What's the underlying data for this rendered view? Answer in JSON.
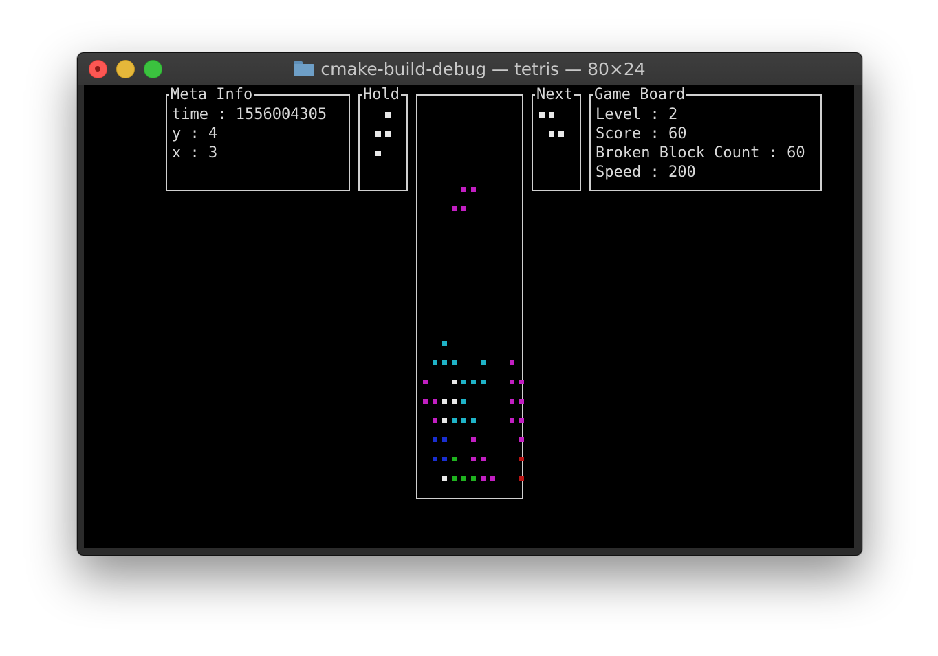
{
  "window": {
    "title": "cmake-build-debug — tetris — 80×24",
    "icon": "folder-icon"
  },
  "meta_info": {
    "label": "Meta Info",
    "time_line": "time : 1556004305",
    "y_line": "y : 4",
    "x_line": "x : 3"
  },
  "hold": {
    "label": "Hold"
  },
  "next": {
    "label": "Next"
  },
  "game_board": {
    "label": "Game Board",
    "level_line": "Level : 2",
    "score_line": "Score : 60",
    "broken_line": "Broken Block Count : 60",
    "speed_line": "Speed : 200"
  },
  "colors": {
    "magenta": "#c21fc2",
    "cyan": "#1fb3c7",
    "white": "#e8e8e8",
    "blue": "#1a2fd0",
    "green": "#1fb31f",
    "red": "#b81414"
  },
  "hold_piece": [
    [
      1,
      0
    ],
    [
      0,
      1
    ],
    [
      1,
      1
    ],
    [
      0,
      2
    ]
  ],
  "next_piece": [
    [
      0,
      0
    ],
    [
      1,
      0
    ],
    [
      1,
      1
    ],
    [
      2,
      1
    ]
  ],
  "falling_piece": [
    {
      "col": 4,
      "row": 5,
      "c": "magenta"
    },
    {
      "col": 5,
      "row": 5,
      "c": "magenta"
    },
    {
      "col": 3,
      "row": 6,
      "c": "magenta"
    },
    {
      "col": 4,
      "row": 6,
      "c": "magenta"
    }
  ],
  "stack": [
    {
      "col": 2,
      "row": 13,
      "c": "cyan"
    },
    {
      "col": 1,
      "row": 14,
      "c": "cyan"
    },
    {
      "col": 2,
      "row": 14,
      "c": "cyan"
    },
    {
      "col": 3,
      "row": 14,
      "c": "cyan"
    },
    {
      "col": 6,
      "row": 14,
      "c": "cyan"
    },
    {
      "col": 9,
      "row": 14,
      "c": "magenta"
    },
    {
      "col": 0,
      "row": 15,
      "c": "magenta"
    },
    {
      "col": 3,
      "row": 15,
      "c": "white"
    },
    {
      "col": 4,
      "row": 15,
      "c": "cyan"
    },
    {
      "col": 5,
      "row": 15,
      "c": "cyan"
    },
    {
      "col": 6,
      "row": 15,
      "c": "cyan"
    },
    {
      "col": 9,
      "row": 15,
      "c": "magenta"
    },
    {
      "col": 10,
      "row": 15,
      "c": "magenta"
    },
    {
      "col": 0,
      "row": 16,
      "c": "magenta"
    },
    {
      "col": 1,
      "row": 16,
      "c": "magenta"
    },
    {
      "col": 2,
      "row": 16,
      "c": "white"
    },
    {
      "col": 3,
      "row": 16,
      "c": "white"
    },
    {
      "col": 4,
      "row": 16,
      "c": "cyan"
    },
    {
      "col": 9,
      "row": 16,
      "c": "magenta"
    },
    {
      "col": 10,
      "row": 16,
      "c": "magenta"
    },
    {
      "col": 1,
      "row": 17,
      "c": "magenta"
    },
    {
      "col": 2,
      "row": 17,
      "c": "white"
    },
    {
      "col": 3,
      "row": 17,
      "c": "cyan"
    },
    {
      "col": 4,
      "row": 17,
      "c": "cyan"
    },
    {
      "col": 5,
      "row": 17,
      "c": "cyan"
    },
    {
      "col": 9,
      "row": 17,
      "c": "magenta"
    },
    {
      "col": 10,
      "row": 17,
      "c": "magenta"
    },
    {
      "col": 1,
      "row": 18,
      "c": "blue"
    },
    {
      "col": 2,
      "row": 18,
      "c": "blue"
    },
    {
      "col": 5,
      "row": 18,
      "c": "magenta"
    },
    {
      "col": 10,
      "row": 18,
      "c": "magenta"
    },
    {
      "col": 1,
      "row": 19,
      "c": "blue"
    },
    {
      "col": 2,
      "row": 19,
      "c": "blue"
    },
    {
      "col": 3,
      "row": 19,
      "c": "green"
    },
    {
      "col": 5,
      "row": 19,
      "c": "magenta"
    },
    {
      "col": 6,
      "row": 19,
      "c": "magenta"
    },
    {
      "col": 10,
      "row": 19,
      "c": "red"
    },
    {
      "col": 2,
      "row": 20,
      "c": "white"
    },
    {
      "col": 3,
      "row": 20,
      "c": "green"
    },
    {
      "col": 4,
      "row": 20,
      "c": "green"
    },
    {
      "col": 5,
      "row": 20,
      "c": "green"
    },
    {
      "col": 6,
      "row": 20,
      "c": "magenta"
    },
    {
      "col": 7,
      "row": 20,
      "c": "magenta"
    },
    {
      "col": 10,
      "row": 20,
      "c": "red"
    }
  ]
}
